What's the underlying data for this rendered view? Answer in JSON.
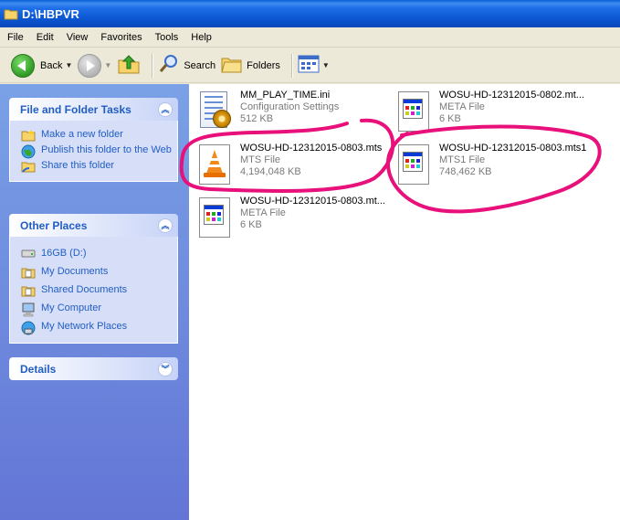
{
  "window": {
    "title": "D:\\HBPVR"
  },
  "menu": [
    "File",
    "Edit",
    "View",
    "Favorites",
    "Tools",
    "Help"
  ],
  "toolbar": {
    "back_label": "Back",
    "search_label": "Search",
    "folders_label": "Folders"
  },
  "sidebar": {
    "tasks": {
      "title": "File and Folder Tasks",
      "items": [
        {
          "label": "Make a new folder",
          "icon": "new-folder-icon"
        },
        {
          "label": "Publish this folder to the Web",
          "icon": "globe-icon"
        },
        {
          "label": "Share this folder",
          "icon": "share-folder-icon"
        }
      ]
    },
    "other_places": {
      "title": "Other Places",
      "items": [
        {
          "label": "16GB (D:)",
          "icon": "drive-icon"
        },
        {
          "label": "My Documents",
          "icon": "my-documents-icon"
        },
        {
          "label": "Shared Documents",
          "icon": "shared-documents-icon"
        },
        {
          "label": "My Computer",
          "icon": "computer-icon"
        },
        {
          "label": "My Network Places",
          "icon": "network-icon"
        }
      ]
    },
    "details": {
      "title": "Details"
    }
  },
  "files": [
    {
      "name": "MM_PLAY_TIME.ini",
      "type": "Configuration Settings",
      "size": "512 KB",
      "icon": "config-settings-icon"
    },
    {
      "name": "WOSU-HD-12312015-0802.mt...",
      "type": "META File",
      "size": "6 KB",
      "icon": "meta-file-icon"
    },
    {
      "name": "WOSU-HD-12312015-0803.mts",
      "type": "MTS File",
      "size": "4,194,048 KB",
      "icon": "vlc-cone-icon"
    },
    {
      "name": "WOSU-HD-12312015-0803.mts1",
      "type": "MTS1 File",
      "size": "748,462 KB",
      "icon": "mts1-file-icon"
    },
    {
      "name": "WOSU-HD-12312015-0803.mt...",
      "type": "META File",
      "size": "6 KB",
      "icon": "meta-file-icon"
    }
  ],
  "colors": {
    "titlebar": "#0a55d0",
    "sidebar_bg": "#6f8fe0",
    "annotation": "#e8107a",
    "link": "#215dc6"
  }
}
